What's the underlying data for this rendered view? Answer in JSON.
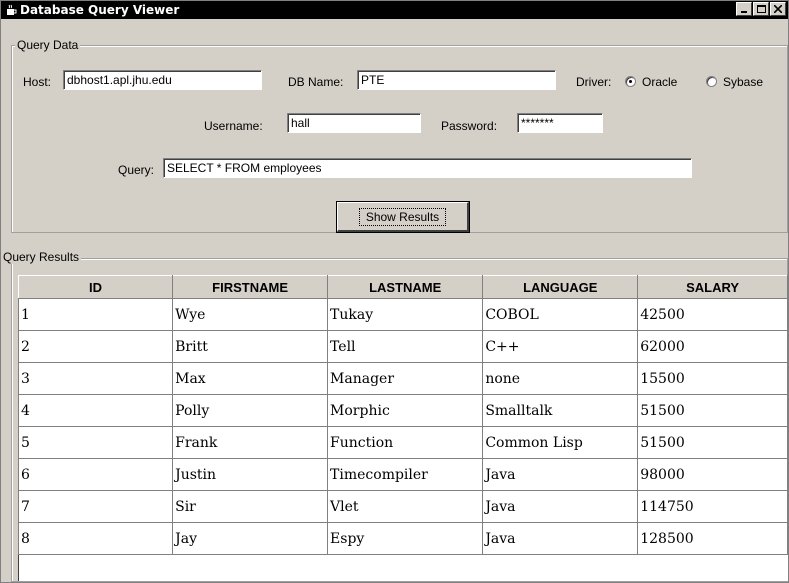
{
  "window": {
    "title": "Database Query Viewer"
  },
  "query_data": {
    "legend": "Query Data",
    "host_label": "Host:",
    "host_value": "dbhost1.apl.jhu.edu",
    "dbname_label": "DB Name:",
    "dbname_value": "PTE",
    "driver_label": "Driver:",
    "driver_options": [
      "Oracle",
      "Sybase"
    ],
    "driver_selected": "Oracle",
    "username_label": "Username:",
    "username_value": "hall",
    "password_label": "Password:",
    "password_value": "*******",
    "query_label": "Query:",
    "query_value": "SELECT * FROM employees",
    "show_results_label": "Show Results"
  },
  "results": {
    "legend": "Query Results",
    "columns": [
      "ID",
      "FIRSTNAME",
      "LASTNAME",
      "LANGUAGE",
      "SALARY"
    ],
    "rows": [
      [
        "1",
        "Wye",
        "Tukay",
        "COBOL",
        "42500"
      ],
      [
        "2",
        "Britt",
        "Tell",
        "C++",
        "62000"
      ],
      [
        "3",
        "Max",
        "Manager",
        "none",
        "15500"
      ],
      [
        "4",
        "Polly",
        "Morphic",
        "Smalltalk",
        "51500"
      ],
      [
        "5",
        "Frank",
        "Function",
        "Common Lisp",
        "51500"
      ],
      [
        "6",
        "Justin",
        "Timecompiler",
        "Java",
        "98000"
      ],
      [
        "7",
        "Sir",
        "Vlet",
        "Java",
        "114750"
      ],
      [
        "8",
        "Jay",
        "Espy",
        "Java",
        "128500"
      ]
    ]
  },
  "icons": {
    "app": "java-cup-icon",
    "minimize": "minimize-icon",
    "maximize": "maximize-icon",
    "close": "close-icon"
  }
}
